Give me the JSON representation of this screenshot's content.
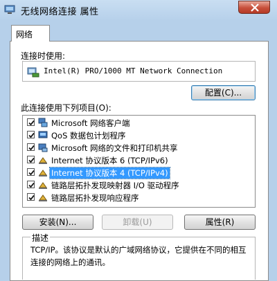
{
  "window": {
    "title": "无线网络连接 属性",
    "close_label": "close",
    "close_color": "#c7503b"
  },
  "tabs": [
    {
      "label": "网络",
      "active": true
    }
  ],
  "connect_using": {
    "label": "连接时使用:",
    "adapter_name": "Intel(R) PRO/1000 MT Network Connection",
    "adapter_icon": "network-adapter-icon"
  },
  "configure_button": "配置(C)...",
  "items_label": "此连接使用下列项目(O):",
  "items": [
    {
      "label": "Microsoft 网络客户端",
      "checked": true,
      "icon": "network-client-icon"
    },
    {
      "label": "QoS 数据包计划程序",
      "checked": true,
      "icon": "qos-icon"
    },
    {
      "label": "Microsoft 网络的文件和打印机共享",
      "checked": true,
      "icon": "file-printer-sharing-icon"
    },
    {
      "label": "Internet 协议版本 6 (TCP/IPv6)",
      "checked": true,
      "icon": "protocol-icon"
    },
    {
      "label": "Internet 协议版本 4 (TCP/IPv4)",
      "checked": true,
      "icon": "protocol-icon",
      "selected": true
    },
    {
      "label": "链路层拓扑发现映射器 I/O 驱动程序",
      "checked": true,
      "icon": "protocol-icon"
    },
    {
      "label": "链路层拓扑发现响应程序",
      "checked": true,
      "icon": "protocol-icon"
    }
  ],
  "buttons": {
    "install": "安装(N)...",
    "uninstall": "卸载(U)",
    "properties": "属性(R)"
  },
  "description": {
    "legend": "描述",
    "text": "TCP/IP。该协议是默认的广域网络协议，它提供在不同的相互连接的网络上的通讯。"
  },
  "colors": {
    "selection": "#3399ff",
    "window_frame": "#b6d0ea"
  }
}
